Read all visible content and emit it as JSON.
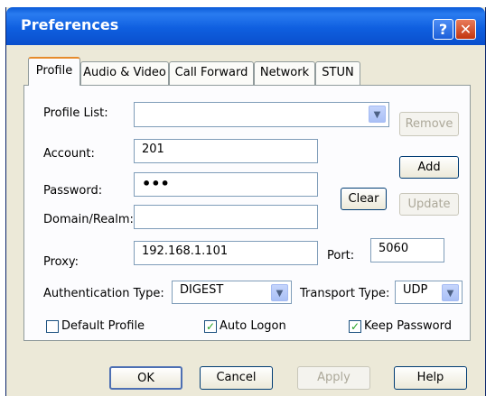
{
  "window": {
    "title": "Preferences"
  },
  "tabs": [
    {
      "label": "Profile",
      "active": true
    },
    {
      "label": "Audio & Video"
    },
    {
      "label": "Call Forward"
    },
    {
      "label": "Network"
    },
    {
      "label": "STUN"
    }
  ],
  "profile": {
    "profile_list_label": "Profile List:",
    "profile_list_value": "",
    "account_label": "Account:",
    "account_value": "201",
    "password_label": "Password:",
    "password_value": "•••",
    "domain_label": "Domain/Realm:",
    "domain_value": "",
    "proxy_label": "Proxy:",
    "proxy_value": "192.168.1.101",
    "port_label": "Port:",
    "port_value": "5060",
    "auth_type_label": "Authentication Type:",
    "auth_type_value": "DIGEST",
    "transport_type_label": "Transport Type:",
    "transport_type_value": "UDP",
    "buttons": {
      "remove": "Remove",
      "add": "Add",
      "clear": "Clear",
      "update": "Update"
    },
    "checkboxes": {
      "default_profile": {
        "label": "Default Profile",
        "checked": false
      },
      "auto_logon": {
        "label": "Auto Logon",
        "checked": true
      },
      "keep_password": {
        "label": "Keep Password",
        "checked": true
      }
    }
  },
  "footer": {
    "ok": "OK",
    "cancel": "Cancel",
    "apply": "Apply",
    "help": "Help"
  },
  "icons": {
    "help": "?",
    "close": "✕",
    "dropdown": "▼",
    "check": "✓"
  }
}
